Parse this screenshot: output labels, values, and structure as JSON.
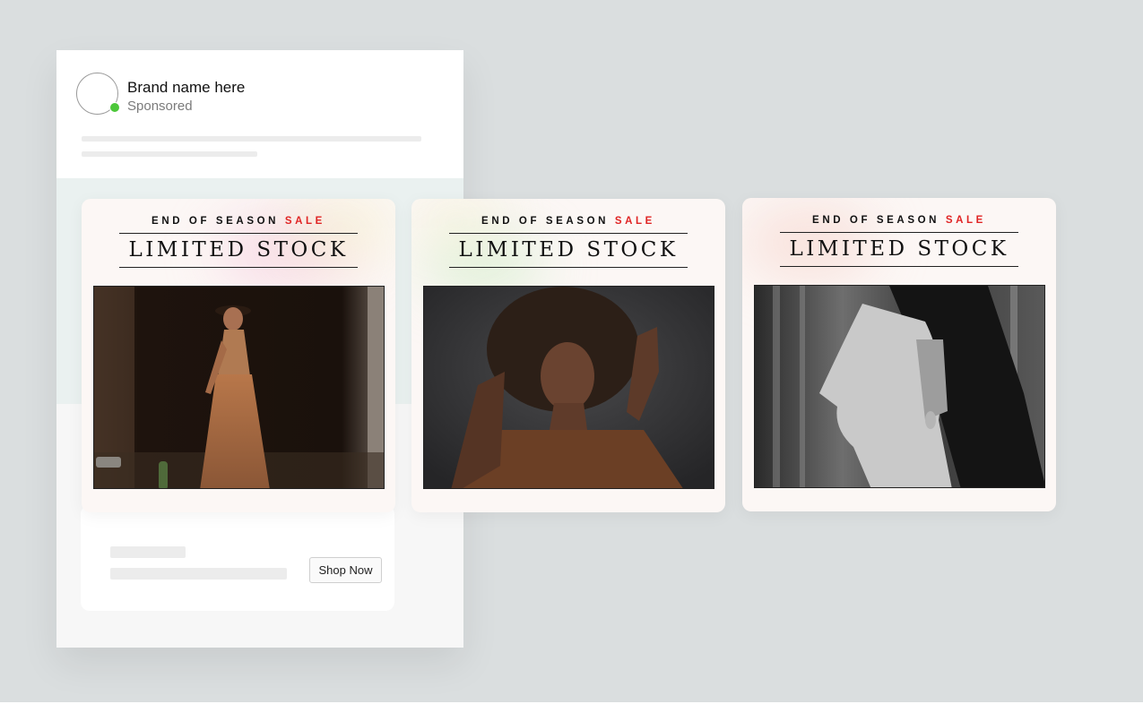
{
  "post": {
    "brand_name": "Brand name here",
    "sponsored": "Sponsored",
    "cta_label": "Shop Now"
  },
  "ads": [
    {
      "eyebrow": "END OF SEASON",
      "sale": "SALE",
      "headline": "LIMITED STOCK",
      "photo": "woman-in-floral-dress-photo"
    },
    {
      "eyebrow": "END OF SEASON",
      "sale": "SALE",
      "headline": "LIMITED STOCK",
      "photo": "woman-with-afro-photo"
    },
    {
      "eyebrow": "END OF SEASON",
      "sale": "SALE",
      "headline": "LIMITED STOCK",
      "photo": "woman-profile-bw-photo"
    }
  ],
  "colors": {
    "sale_red": "#e02424",
    "online_green": "#4cc73a",
    "background": "#dadedf"
  }
}
